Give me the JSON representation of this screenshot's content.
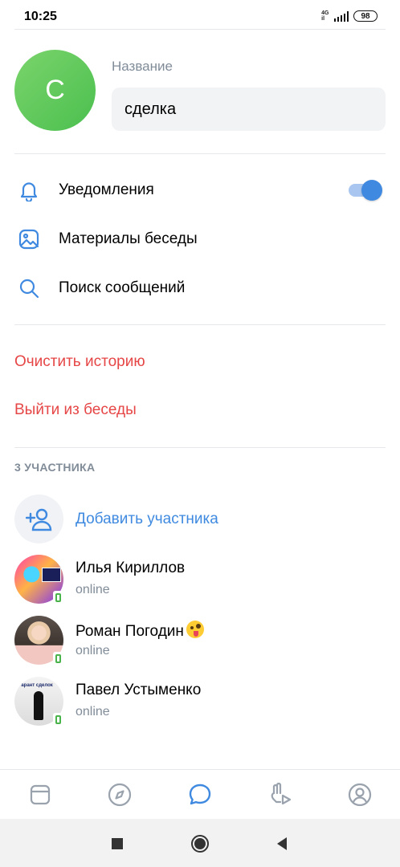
{
  "status_bar": {
    "time": "10:25",
    "network_top": "4G",
    "network_bottom": "il",
    "battery": "98"
  },
  "header": {
    "avatar_letter": "С",
    "name_label": "Название",
    "name_value": "сделка"
  },
  "menu": {
    "notifications": {
      "label": "Уведомления",
      "icon": "bell-icon",
      "toggle_on": true
    },
    "media": {
      "label": "Материалы беседы",
      "icon": "image-icon"
    },
    "search": {
      "label": "Поиск сообщений",
      "icon": "search-icon"
    }
  },
  "actions": {
    "clear_history": "Очистить историю",
    "leave_chat": "Выйти из беседы"
  },
  "members": {
    "header": "3 УЧАСТНИКА",
    "add_label": "Добавить участника",
    "list": [
      {
        "name": "Илья Кириллов",
        "status": "online"
      },
      {
        "name": "Роман Погодин",
        "status": "online",
        "emoji": "zany-face"
      },
      {
        "name": "Павел Устыменко",
        "status": "online",
        "avatar_text": "Гарант сделок"
      }
    ]
  },
  "tabs": [
    "newsfeed-icon",
    "discover-icon",
    "messages-icon",
    "clips-icon",
    "profile-icon"
  ],
  "colors": {
    "accent": "#3f8ae0",
    "danger": "#e64646",
    "secondary_text": "#818c99",
    "avatar_green": "#5cc95a"
  }
}
